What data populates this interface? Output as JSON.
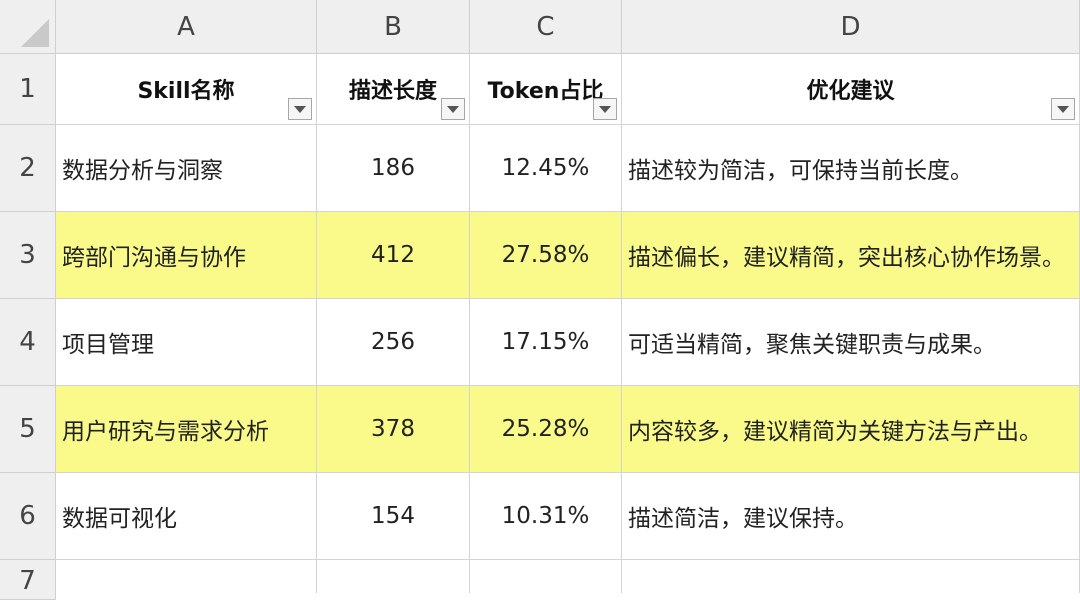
{
  "columns": [
    "A",
    "B",
    "C",
    "D"
  ],
  "row_numbers": [
    "1",
    "2",
    "3",
    "4",
    "5",
    "6",
    "7"
  ],
  "headers": [
    "Skill名称",
    "描述长度",
    "Token占比",
    "优化建议"
  ],
  "rows": [
    {
      "skill": "数据分析与洞察",
      "length": "186",
      "token": "12.45%",
      "advice": "描述较为简洁，可保持当前长度。",
      "highlight": false
    },
    {
      "skill": "跨部门沟通与协作",
      "length": "412",
      "token": "27.58%",
      "advice": "描述偏长，建议精简，突出核心协作场景。",
      "highlight": true
    },
    {
      "skill": "项目管理",
      "length": "256",
      "token": "17.15%",
      "advice": "可适当精简，聚焦关键职责与成果。",
      "highlight": false
    },
    {
      "skill": "用户研究与需求分析",
      "length": "378",
      "token": "25.28%",
      "advice": "内容较多，建议精简为关键方法与产出。",
      "highlight": true
    },
    {
      "skill": "数据可视化",
      "length": "154",
      "token": "10.31%",
      "advice": "描述简洁，建议保持。",
      "highlight": false
    }
  ],
  "colors": {
    "highlight": "#fafa8a",
    "header_bg": "#efefef"
  },
  "icons": {
    "filter": "filter-dropdown-icon",
    "select_all": "select-all-triangle-icon"
  }
}
